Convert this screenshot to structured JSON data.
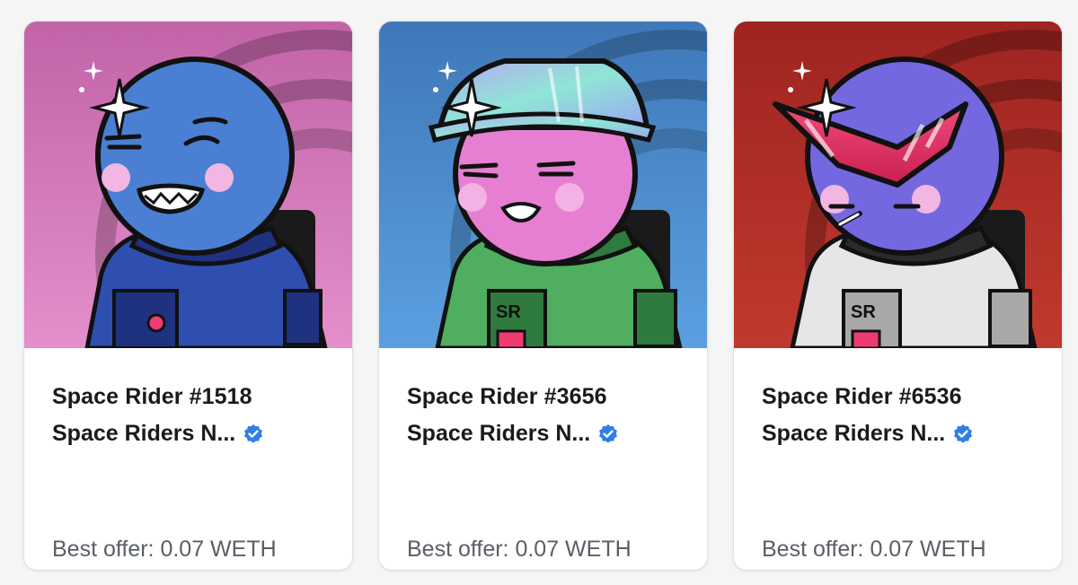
{
  "cards": [
    {
      "name": "Space Rider #1518",
      "collection": "Space Riders N...",
      "offer_label": "Best offer:",
      "offer_value": "0.07 WETH",
      "colors": {
        "bg_top": "#c263a8",
        "bg_bottom": "#e48fcb",
        "skin": "#4a7fd4",
        "suit": "#2e4fb0",
        "suit_dark": "#1f3280"
      }
    },
    {
      "name": "Space Rider #3656",
      "collection": "Space Riders N...",
      "offer_label": "Best offer:",
      "offer_value": "0.07 WETH",
      "colors": {
        "bg_top": "#3f78b8",
        "bg_bottom": "#5aa0e0",
        "skin": "#e67fd2",
        "suit": "#4fae5f",
        "suit_dark": "#2f7a3e"
      }
    },
    {
      "name": "Space Rider #6536",
      "collection": "Space Riders N...",
      "offer_label": "Best offer:",
      "offer_value": "0.07 WETH",
      "colors": {
        "bg_top": "#9e2420",
        "bg_bottom": "#c0392e",
        "skin": "#7468e0",
        "suit": "#e6e6e6",
        "suit_dark": "#a8a8a8"
      }
    }
  ],
  "icons": {
    "verified": "verified-badge-icon",
    "sparkle": "sparkle-icon"
  },
  "accent": "#2f7ee8"
}
